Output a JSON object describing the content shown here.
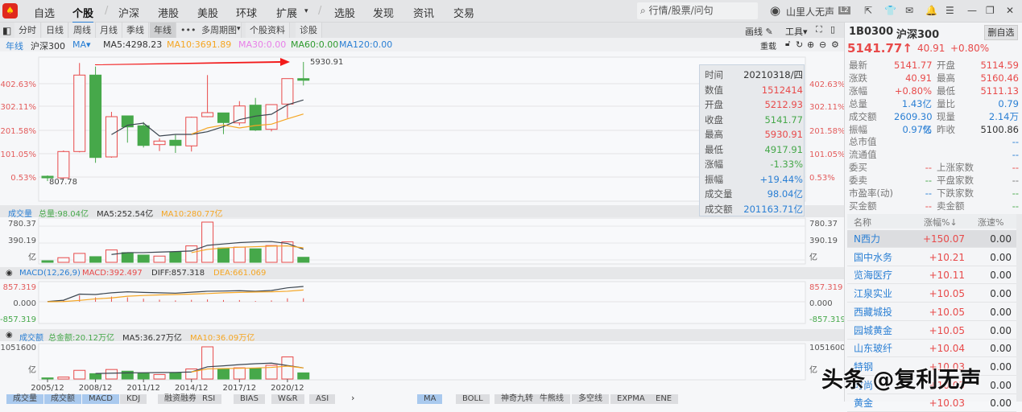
{
  "nav": {
    "items": [
      "自选",
      "个股",
      "沪深",
      "港股",
      "美股",
      "环球",
      "扩展",
      "选股",
      "发现",
      "资讯",
      "交易"
    ],
    "search_placeholder": "行情/股票/问句",
    "user": "山里人无声",
    "level": "L2"
  },
  "toolbar": {
    "tabs": [
      "分时",
      "日线",
      "周线",
      "月线",
      "季线",
      "年线",
      "•••",
      "多周期图",
      "个股资料",
      "诊股"
    ],
    "draw": "画线",
    "tools": "工具",
    "restore": "重载"
  },
  "legend": {
    "period": "年线",
    "name": "沪深300",
    "ma": "MA",
    "ma5": "MA5:4298.23",
    "ma10": "MA10:3691.89",
    "ma30": "MA30:0.00",
    "ma60": "MA60:0.00",
    "ma120": "MA120:0.00"
  },
  "colors": {
    "up": "#e84a4a",
    "down": "#46a84a",
    "ma5": "#3c4650",
    "ma10": "#f5a623",
    "accent": "#2a7fd4"
  },
  "chart_data": [
    {
      "type": "candlestick",
      "title": "沪深300 年线",
      "x": [
        "2005",
        "2006",
        "2007",
        "2008",
        "2009",
        "2010",
        "2011",
        "2012",
        "2013",
        "2014",
        "2015",
        "2016",
        "2017",
        "2018",
        "2019",
        "2020",
        "2021"
      ],
      "ohlc": [
        [
          1015,
          1050,
          807.78,
          946
        ],
        [
          946,
          2123,
          912,
          2078
        ],
        [
          2078,
          5885,
          2043,
          5366
        ],
        [
          5366,
          5733,
          1593,
          1822
        ],
        [
          1846,
          3784,
          1812,
          3577
        ],
        [
          3611,
          3611,
          2459,
          3137
        ],
        [
          3186,
          3345,
          2251,
          2341
        ],
        [
          2376,
          2642,
          2099,
          2528
        ],
        [
          2563,
          2791,
          2019,
          2341
        ],
        [
          2320,
          3577,
          2078,
          3552
        ],
        [
          3577,
          5366,
          3552,
          3750
        ],
        [
          3739,
          3750,
          2826,
          3324
        ],
        [
          3310,
          4245,
          3206,
          4037
        ],
        [
          4072,
          4383,
          2964,
          3001
        ],
        [
          3033,
          4096,
          2943,
          4096
        ],
        [
          4120,
          5214,
          3518,
          5214
        ],
        [
          5212.93,
          5930.91,
          4917.91,
          5141.77
        ]
      ],
      "ma5": [
        null,
        null,
        null,
        null,
        2805,
        3206,
        3300,
        2746,
        2815,
        2815,
        2929,
        3151,
        3449,
        3601,
        3681,
        4085,
        4298.23
      ],
      "ma10": [
        null,
        null,
        null,
        null,
        null,
        null,
        null,
        null,
        null,
        2826,
        3092,
        3220,
        3092,
        3196,
        3255,
        3483,
        3691.89
      ],
      "y_ticks": [
        "402.63%",
        "302.11%",
        "201.58%",
        "101.05%",
        "0.53%"
      ],
      "low_label": "807.78",
      "high_label": "5930.91",
      "ylim": [
        807.78,
        5930.91
      ]
    },
    {
      "type": "bar",
      "title": "成交量",
      "unit": "亿",
      "values": [
        31,
        90,
        173,
        110,
        240,
        188,
        141,
        121,
        199,
        319,
        780.37,
        278,
        294,
        262,
        325,
        397,
        98.04
      ],
      "ma5": [
        null,
        null,
        null,
        null,
        152,
        188,
        188,
        199,
        209,
        220,
        330,
        356,
        382,
        397,
        403,
        366,
        252.54
      ],
      "ma10": [
        null,
        null,
        null,
        null,
        null,
        null,
        null,
        null,
        null,
        188,
        251,
        278,
        294,
        303,
        314,
        319,
        280.77
      ],
      "y_ticks": [
        "780.37",
        "390.19",
        "亿"
      ]
    },
    {
      "type": "line",
      "title": "MACD(12,26,9)",
      "diff": [
        11,
        85,
        428,
        407,
        503,
        557,
        525,
        503,
        482,
        535,
        589,
        600,
        621,
        589,
        632,
        782,
        857.318
      ],
      "dea": [
        0,
        11,
        75,
        161,
        214,
        310,
        353,
        385,
        407,
        428,
        460,
        503,
        525,
        546,
        557,
        589,
        661.069
      ],
      "macd": [
        22,
        148,
        706,
        492,
        578,
        494,
        344,
        236,
        150,
        214,
        258,
        194,
        192,
        86,
        150,
        386,
        392.497
      ],
      "y_ticks": [
        "857.319",
        "0.000",
        "-857.319"
      ]
    },
    {
      "type": "bar",
      "title": "成交额",
      "unit": "亿",
      "values": [
        36600,
        64000,
        283000,
        174000,
        311000,
        256000,
        192000,
        146000,
        201000,
        329000,
        1051600,
        329000,
        365000,
        347000,
        448000,
        722000,
        201163.71
      ],
      "ma5": [
        null,
        null,
        null,
        180000,
        190000,
        200000,
        205000,
        210000,
        215000,
        230000,
        400000,
        430000,
        470000,
        500000,
        520000,
        440000,
        362700
      ],
      "ma10": [
        null,
        null,
        null,
        null,
        null,
        null,
        null,
        null,
        null,
        230000,
        330000,
        340000,
        350000,
        360000,
        380000,
        420000,
        360900
      ],
      "y_ticks": [
        "1051600",
        "亿"
      ],
      "x_ticks": [
        "2005/12",
        "2008/12",
        "2011/12",
        "2014/12",
        "2017/12",
        "2020/12"
      ]
    }
  ],
  "tooltip": [
    [
      "时间",
      "20210318/四",
      "blk"
    ],
    [
      "数值",
      "1512414",
      "red"
    ],
    [
      "开盘",
      "5212.93",
      "red"
    ],
    [
      "收盘",
      "5141.77",
      "grn"
    ],
    [
      "最高",
      "5930.91",
      "red"
    ],
    [
      "最低",
      "4917.91",
      "grn"
    ],
    [
      "涨幅",
      "-1.33%",
      "grn"
    ],
    [
      "振幅",
      "+19.44%",
      "blu"
    ],
    [
      "成交量",
      "98.04亿",
      "blu"
    ],
    [
      "成交额",
      "201163.71亿",
      "blu"
    ]
  ],
  "vol_head": {
    "title": "成交量",
    "total": "总量:98.04亿",
    "ma5": "MA5:252.54亿",
    "ma10": "MA10:280.77亿"
  },
  "macd_head": {
    "title": "MACD(12,26,9)",
    "macd": "MACD:392.497",
    "diff": "DIFF:857.318",
    "dea": "DEA:661.069"
  },
  "amt_head": {
    "title": "成交额",
    "total": "总金额:20.12万亿",
    "ma5": "MA5:36.27万亿",
    "ma10": "MA10:36.09万亿"
  },
  "stock": {
    "code": "1B0300",
    "name": "沪深300",
    "price": "5141.77",
    "change": "40.91",
    "pct": "+0.80%",
    "remove": "删自选"
  },
  "quote": [
    [
      "最新",
      "5141.77",
      "red",
      "开盘",
      "5114.59",
      "red"
    ],
    [
      "涨跌",
      "40.91",
      "red",
      "最高",
      "5160.46",
      "red"
    ],
    [
      "涨幅",
      "+0.80%",
      "red",
      "最低",
      "5111.13",
      "red"
    ],
    [
      "总量",
      "1.43亿",
      "blu",
      "量比",
      "0.79",
      "blu"
    ],
    [
      "成交额",
      "2609.30亿",
      "blu",
      "现量",
      "2.14万",
      "blu"
    ],
    [
      "振幅",
      "0.97%",
      "blu",
      "昨收",
      "5100.86",
      "blk"
    ],
    [
      "总市值",
      "",
      "",
      "",
      "--",
      "blu"
    ],
    [
      "流通值",
      "",
      "",
      "",
      "--",
      "blu"
    ],
    [
      "委买",
      "--",
      "red",
      "上涨家数",
      "--",
      "red"
    ],
    [
      "委卖",
      "--",
      "grn",
      "平盘家数",
      "--",
      "gry"
    ],
    [
      "市盈率(动)",
      "--",
      "blu",
      "下跌家数",
      "--",
      "grn"
    ],
    [
      "买金额",
      "--",
      "red",
      "卖金额",
      "--",
      "grn"
    ]
  ],
  "watch": {
    "headers": [
      "名称",
      "涨幅%↓",
      "涨速%"
    ],
    "rows": [
      [
        "N西力",
        "+150.07",
        "0.00"
      ],
      [
        "国中水务",
        "+10.21",
        "0.00"
      ],
      [
        "览海医疗",
        "+10.11",
        "0.00"
      ],
      [
        "江泉实业",
        "+10.05",
        "0.00"
      ],
      [
        "西藏城投",
        "+10.05",
        "0.00"
      ],
      [
        "园城黄金",
        "+10.05",
        "0.00"
      ],
      [
        "山东玻纤",
        "+10.04",
        "0.00"
      ],
      [
        "特钢",
        "+10.03",
        "0.00"
      ],
      [
        "时尚",
        "+10.03",
        "0.00"
      ],
      [
        "黄金",
        "+10.03",
        "0.00"
      ]
    ]
  },
  "bottom_tabs": {
    "left": [
      "成交量",
      "成交额",
      "MACD",
      "KDJ",
      "融资融券",
      "RSI",
      "BIAS",
      "W&R",
      "ASI"
    ],
    "right": [
      "MA",
      "BOLL",
      "神奇九转",
      "牛熊线",
      "多空线",
      "EXPMA",
      "ENE"
    ]
  },
  "watermark": "头条 @复利无声"
}
